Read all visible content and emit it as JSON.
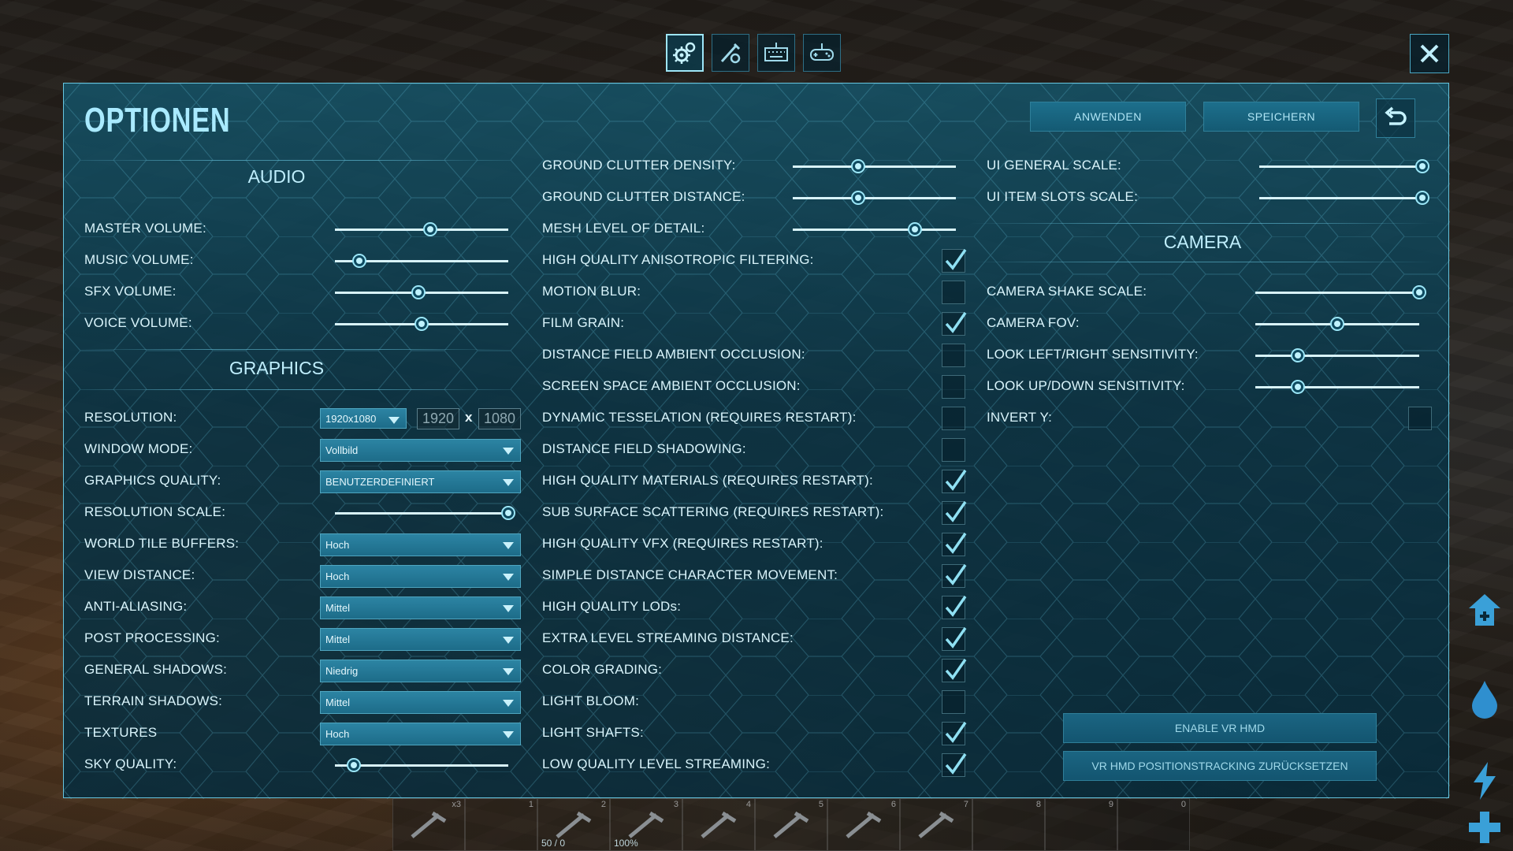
{
  "header": {
    "tabs": [
      {
        "name": "general-settings",
        "icon": "gears-icon",
        "active": true
      },
      {
        "name": "advanced-settings",
        "icon": "tools-icon",
        "active": false
      },
      {
        "name": "keybindings",
        "icon": "keyboard-icon",
        "active": false
      },
      {
        "name": "gamepad",
        "icon": "gamepad-icon",
        "active": false
      }
    ],
    "close_icon": "close-icon"
  },
  "panel": {
    "title": "OPTIONEN",
    "apply_label": "ANWENDEN",
    "save_label": "SPEICHERN",
    "undo_icon": "undo-icon"
  },
  "audio": {
    "heading": "AUDIO",
    "master_volume": {
      "label": "MASTER VOLUME:",
      "value": 0.55
    },
    "music_volume": {
      "label": "MUSIC VOLUME:",
      "value": 0.14
    },
    "sfx_volume": {
      "label": "SFX VOLUME:",
      "value": 0.48
    },
    "voice_volume": {
      "label": "VOICE VOLUME:",
      "value": 0.5
    }
  },
  "graphics": {
    "heading": "GRAPHICS",
    "resolution": {
      "label": "RESOLUTION:",
      "selected": "1920x1080",
      "width": "1920",
      "x": "x",
      "height": "1080"
    },
    "window_mode": {
      "label": "WINDOW MODE:",
      "selected": "Vollbild"
    },
    "graphics_quality": {
      "label": "GRAPHICS QUALITY:",
      "selected": "BENUTZERDEFINIERT"
    },
    "resolution_scale": {
      "label": "RESOLUTION SCALE:",
      "value": 1.0
    },
    "world_tile_buffers": {
      "label": "WORLD TILE BUFFERS:",
      "selected": "Hoch"
    },
    "view_distance": {
      "label": "VIEW DISTANCE:",
      "selected": "Hoch"
    },
    "anti_aliasing": {
      "label": "ANTI-ALIASING:",
      "selected": "Mittel"
    },
    "post_processing": {
      "label": "POST PROCESSING:",
      "selected": "Mittel"
    },
    "general_shadows": {
      "label": "GENERAL SHADOWS:",
      "selected": "Niedrig"
    },
    "terrain_shadows": {
      "label": "TERRAIN SHADOWS:",
      "selected": "Mittel"
    },
    "textures": {
      "label": "TEXTURES",
      "selected": "Hoch"
    },
    "sky_quality": {
      "label": "SKY QUALITY:",
      "value": 0.11
    }
  },
  "middle": {
    "ground_clutter_density": {
      "label": "GROUND CLUTTER DENSITY:",
      "value": 0.4
    },
    "ground_clutter_distance": {
      "label": "GROUND CLUTTER DISTANCE:",
      "value": 0.4
    },
    "mesh_level_of_detail": {
      "label": "MESH LEVEL OF DETAIL:",
      "value": 0.75
    },
    "checkboxes": [
      {
        "label": "HIGH QUALITY ANISOTROPIC FILTERING:",
        "checked": true
      },
      {
        "label": "MOTION BLUR:",
        "checked": false
      },
      {
        "label": "FILM GRAIN:",
        "checked": true
      },
      {
        "label": "DISTANCE FIELD AMBIENT OCCLUSION:",
        "checked": false
      },
      {
        "label": "SCREEN SPACE AMBIENT OCCLUSION:",
        "checked": false
      },
      {
        "label": "DYNAMIC TESSELATION (REQUIRES RESTART):",
        "checked": false
      },
      {
        "label": "DISTANCE FIELD SHADOWING:",
        "checked": false
      },
      {
        "label": "HIGH QUALITY MATERIALS (REQUIRES RESTART):",
        "checked": true
      },
      {
        "label": "SUB SURFACE SCATTERING (REQUIRES RESTART):",
        "checked": true
      },
      {
        "label": "HIGH QUALITY VFX (REQUIRES RESTART):",
        "checked": true
      },
      {
        "label": "SIMPLE DISTANCE CHARACTER MOVEMENT:",
        "checked": true
      },
      {
        "label": "HIGH QUALITY LODs:",
        "checked": true
      },
      {
        "label": "EXTRA LEVEL STREAMING DISTANCE:",
        "checked": true
      },
      {
        "label": "COLOR GRADING:",
        "checked": true
      },
      {
        "label": "LIGHT BLOOM:",
        "checked": false
      },
      {
        "label": "LIGHT SHAFTS:",
        "checked": true
      },
      {
        "label": "LOW QUALITY LEVEL STREAMING:",
        "checked": true
      }
    ]
  },
  "right": {
    "ui_general_scale": {
      "label": "UI GENERAL SCALE:",
      "value": 1.0
    },
    "ui_item_slots_scale": {
      "label": "UI ITEM SLOTS SCALE:",
      "value": 1.0
    },
    "camera_heading": "CAMERA",
    "camera_shake_scale": {
      "label": "CAMERA SHAKE SCALE:",
      "value": 1.0
    },
    "camera_fov": {
      "label": "CAMERA FOV:",
      "value": 0.5
    },
    "look_lr_sensitivity": {
      "label": "LOOK LEFT/RIGHT SENSITIVITY:",
      "value": 0.26
    },
    "look_ud_sensitivity": {
      "label": "LOOK UP/DOWN SENSITIVITY:",
      "value": 0.26
    },
    "invert_y": {
      "label": "INVERT Y:",
      "checked": false
    },
    "enable_vr_label": "ENABLE VR HMD",
    "reset_vr_label": "VR HMD POSITIONSTRACKING ZURÜCKSETZEN"
  },
  "hotbar": {
    "slots": [
      {
        "num": "x3",
        "info": "",
        "icon": "pickaxe-icon"
      },
      {
        "num": "1",
        "info": "",
        "icon": "empty"
      },
      {
        "num": "2",
        "info": "50 / 0",
        "icon": "crossbow-icon"
      },
      {
        "num": "3",
        "info": "100%",
        "icon": "bow-icon"
      },
      {
        "num": "4",
        "info": "",
        "icon": "spear-icon"
      },
      {
        "num": "5",
        "info": "",
        "icon": "shotgun-icon"
      },
      {
        "num": "6",
        "info": "",
        "icon": "grappling-hook-icon"
      },
      {
        "num": "7",
        "info": "",
        "icon": "flare-gun-icon"
      },
      {
        "num": "8",
        "info": "",
        "icon": "empty"
      },
      {
        "num": "9",
        "info": "",
        "icon": "empty"
      },
      {
        "num": "0",
        "info": "",
        "icon": "empty"
      }
    ]
  },
  "colors": {
    "accent": "#67c6e0",
    "panel": "#14566c",
    "text": "#d9f4fb"
  }
}
